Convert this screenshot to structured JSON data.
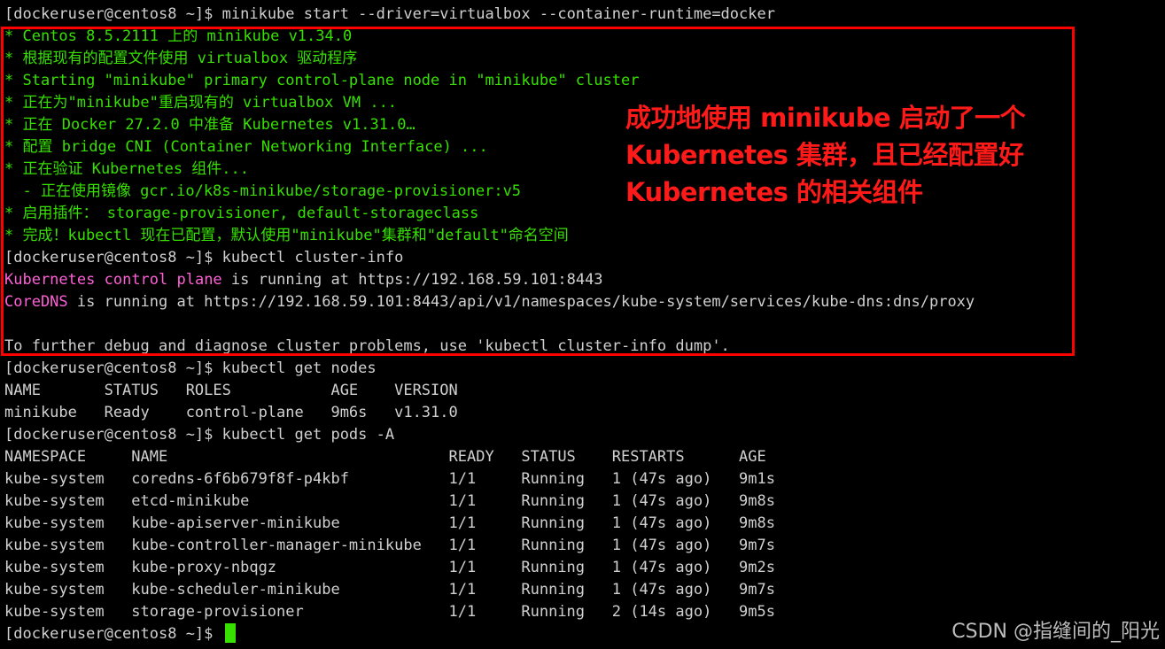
{
  "terminal": {
    "line1": {
      "prompt": "[dockeruser@centos8 ~]$ ",
      "cmd": "minikube start --driver=virtualbox --container-runtime=docker"
    },
    "line2": "* Centos 8.5.2111 上的 minikube v1.34.0",
    "line3": "* 根据现有的配置文件使用 virtualbox 驱动程序",
    "line4": "* Starting \"minikube\" primary control-plane node in \"minikube\" cluster",
    "line5": "* 正在为\"minikube\"重启现有的 virtualbox VM ...",
    "line6": "* 正在 Docker 27.2.0 中准备 Kubernetes v1.31.0…",
    "line7": "* 配置 bridge CNI (Container Networking Interface) ...",
    "line8": "* 正在验证 Kubernetes 组件...",
    "line9": "  - 正在使用镜像 gcr.io/k8s-minikube/storage-provisioner:v5",
    "line10": "* 启用插件： storage-provisioner, default-storageclass",
    "line11": "* 完成！kubectl 现在已配置，默认使用\"minikube\"集群和\"default\"命名空间",
    "line12": {
      "prompt": "[dockeruser@centos8 ~]$ ",
      "cmd": "kubectl cluster-info"
    },
    "line13": {
      "a": "Kubernetes",
      "b": " ",
      "c": "control plane",
      "d": " is running at https://192.168.59.101:8443"
    },
    "line14": {
      "a": "CoreDNS",
      "b": " is running at https://192.168.59.101:8443/api/v1/namespaces/kube-system/services/kube-dns:dns/proxy"
    },
    "line15": "",
    "line16": "To further debug and diagnose cluster problems, use 'kubectl cluster-info dump'.",
    "line17": {
      "prompt": "[dockeruser@centos8 ~]$ ",
      "cmd": "kubectl get nodes"
    },
    "line18": "NAME       STATUS   ROLES           AGE    VERSION",
    "line19": "minikube   Ready    control-plane   9m6s   v1.31.0",
    "line20": {
      "prompt": "[dockeruser@centos8 ~]$ ",
      "cmd": "kubectl get pods -A"
    },
    "line21": "NAMESPACE     NAME                               READY   STATUS    RESTARTS      AGE",
    "line22": "kube-system   coredns-6f6b679f8f-p4kbf           1/1     Running   1 (47s ago)   9m1s",
    "line23": "kube-system   etcd-minikube                      1/1     Running   1 (47s ago)   9m8s",
    "line24": "kube-system   kube-apiserver-minikube            1/1     Running   1 (47s ago)   9m8s",
    "line25": "kube-system   kube-controller-manager-minikube   1/1     Running   1 (47s ago)   9m7s",
    "line26": "kube-system   kube-proxy-nbqgz                   1/1     Running   1 (47s ago)   9m2s",
    "line27": "kube-system   kube-scheduler-minikube            1/1     Running   1 (47s ago)   9m7s",
    "line28": "kube-system   storage-provisioner                1/1     Running   2 (14s ago)   9m5s",
    "line29": {
      "prompt": "[dockeruser@centos8 ~]$ "
    }
  },
  "annotation": {
    "line1": "成功地使用 minikube 启动了一个",
    "line2": "Kubernetes 集群，且已经配置好",
    "line3": "Kubernetes 的相关组件"
  },
  "watermark": "CSDN @指缝间的_阳光",
  "colors": {
    "text_green": "#37e000",
    "text_white": "#d0d0d0",
    "text_pink": "#ff5fd7",
    "highlight_box": "#ff0000",
    "annotation_red": "#ff1a1a",
    "background": "#000000"
  }
}
